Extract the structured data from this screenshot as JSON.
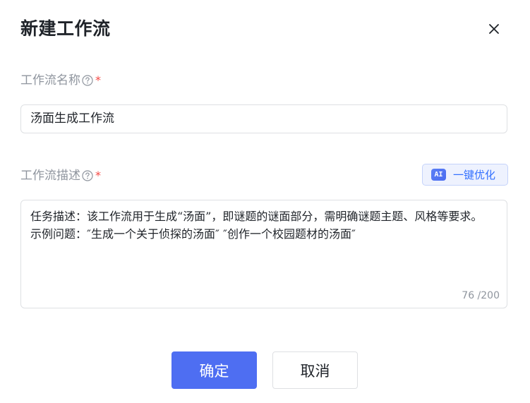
{
  "dialog": {
    "title": "新建工作流",
    "close_icon": "close-icon"
  },
  "name_field": {
    "label": "工作流名称",
    "required_mark": "*",
    "help_icon": "question-circle-icon",
    "value": "汤面生成工作流"
  },
  "description_field": {
    "label": "工作流描述",
    "required_mark": "*",
    "help_icon": "question-circle-icon",
    "value": "任务描述：该工作流用于生成“汤面”，即谜题的谜面部分，需明确谜题主题、风格等要求。\n示例问题：″生成一个关于侦探的汤面″ ″创作一个校园题材的汤面″",
    "char_count": "76 /200",
    "ai_optimize": {
      "badge": "AI",
      "label": "一键优化"
    }
  },
  "actions": {
    "confirm_label": "确定",
    "cancel_label": "取消"
  },
  "colors": {
    "primary": "#4e6ef2",
    "required": "#f54a45",
    "label": "#8f959e",
    "ai_accent": "#3370ff"
  }
}
